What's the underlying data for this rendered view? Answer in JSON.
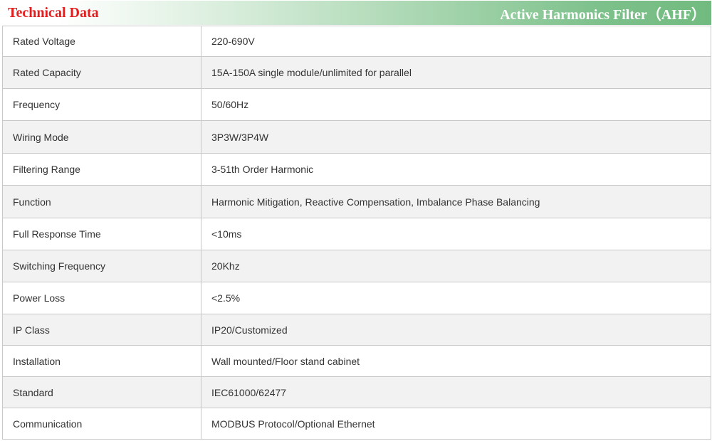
{
  "header": {
    "left_title": "Technical Data",
    "right_title": "Active Harmonics Filter（AHF）"
  },
  "colors": {
    "left_title": "#e21e1e",
    "header_gradient_end": "#72bb80",
    "row_alt": "#f2f2f2",
    "border": "#c8c8c8"
  },
  "rows": [
    {
      "label": "Rated Voltage",
      "value": "220-690V"
    },
    {
      "label": "Rated Capacity",
      "value": "15A-150A single module/unlimited for parallel"
    },
    {
      "label": "Frequency",
      "value": "50/60Hz"
    },
    {
      "label": "Wiring Mode",
      "value": "3P3W/3P4W"
    },
    {
      "label": "Filtering Range",
      "value": "3-51th Order Harmonic"
    },
    {
      "label": "Function",
      "value": "Harmonic Mitigation, Reactive Compensation, Imbalance Phase Balancing"
    },
    {
      "label": "Full Response Time",
      "value": "<10ms"
    },
    {
      "label": "Switching Frequency",
      "value": "20Khz"
    },
    {
      "label": "Power Loss",
      "value": "<2.5%"
    },
    {
      "label": "IP Class",
      "value": "IP20/Customized"
    },
    {
      "label": "Installation",
      "value": "Wall mounted/Floor stand cabinet"
    },
    {
      "label": "Standard",
      "value": "IEC61000/62477"
    },
    {
      "label": "Communication",
      "value": "MODBUS Protocol/Optional Ethernet"
    }
  ]
}
